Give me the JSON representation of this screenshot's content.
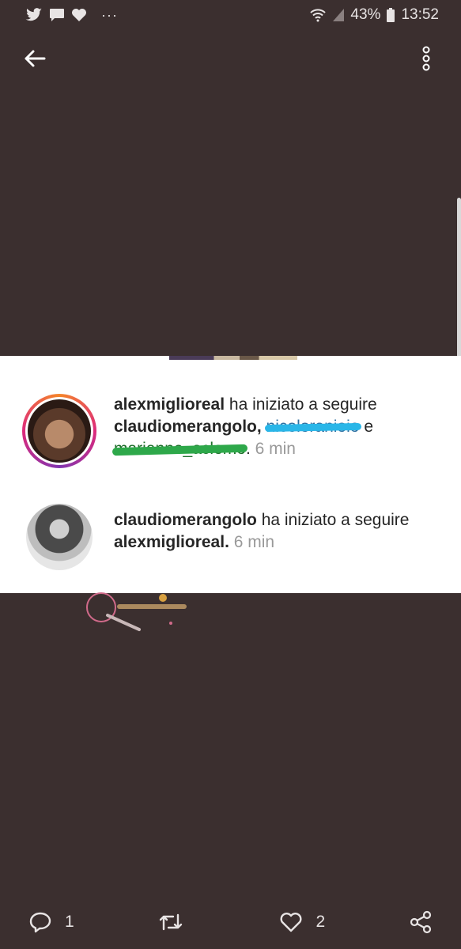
{
  "status_bar": {
    "battery": "43%",
    "time": "13:52",
    "overflow_glyph": "···"
  },
  "notifications": [
    {
      "username": "alexmiglioreal",
      "action": " ha iniziato a seguire",
      "target": "claudiomerangolo,",
      "redacted_1": "nicoloranioio",
      "conjunction": "e",
      "redacted_2": "marianne_aclemo",
      "punct": ".",
      "time": " 6 min"
    },
    {
      "username": "claudiomerangolo",
      "action": " ha iniziato a seguire",
      "target": "alexmiglioreal.",
      "time": " 6 min"
    }
  ],
  "actions": {
    "reply_count": "1",
    "retweet_count": "",
    "like_count": "2"
  },
  "colors": {
    "background": "#3b2f2f",
    "blue_scribble": "#29b6e8",
    "green_scribble": "#2ea84a"
  }
}
